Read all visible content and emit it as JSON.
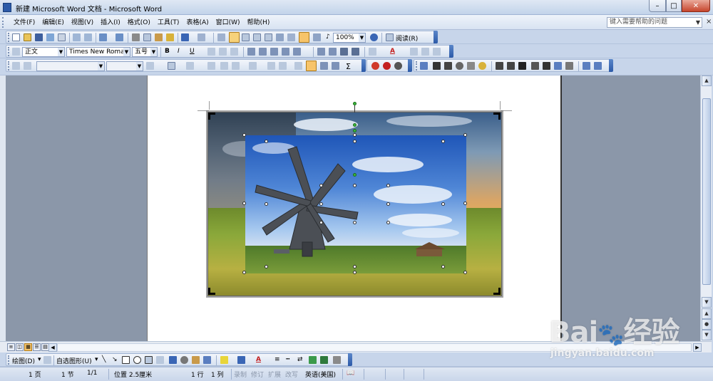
{
  "window": {
    "title": "新建 Microsoft Word 文档 - Microsoft Word",
    "minimize": "–",
    "maximize": "□",
    "close": "✕"
  },
  "menubar": {
    "items": [
      "文件(F)",
      "编辑(E)",
      "视图(V)",
      "插入(I)",
      "格式(O)",
      "工具(T)",
      "表格(A)",
      "窗口(W)",
      "帮助(H)"
    ],
    "help_placeholder": "键入需要帮助的问题",
    "close_doc": "×"
  },
  "standard_toolbar": {
    "zoom": "100%",
    "read_label": "阅读(R)"
  },
  "formatting_toolbar": {
    "style": "正文",
    "font": "Times New Roman",
    "size": "五号",
    "bold": "B",
    "italic": "I",
    "underline": "U",
    "sigma": "Σ"
  },
  "drawing_toolbar": {
    "draw_label": "绘图(D)",
    "autoshapes_label": "自选图形(U)"
  },
  "statusbar": {
    "page": "1 页",
    "section": "1 节",
    "page_of": "1/1",
    "position": "位置 2.5厘米",
    "line": "1 行",
    "column": "1 列",
    "rec": "录制",
    "trk": "修订",
    "ext": "扩展",
    "ovr": "改写",
    "language": "英语(美国)"
  },
  "watermark": {
    "brand": "Bai",
    "brand_cn": "经验",
    "url": "jingyan.baidu.com"
  },
  "colors": {
    "titlebar": "#c2d3ea",
    "toolbar": "#c7d5ea",
    "close_button": "#c7452c",
    "doc_background": "#8b97a9"
  }
}
